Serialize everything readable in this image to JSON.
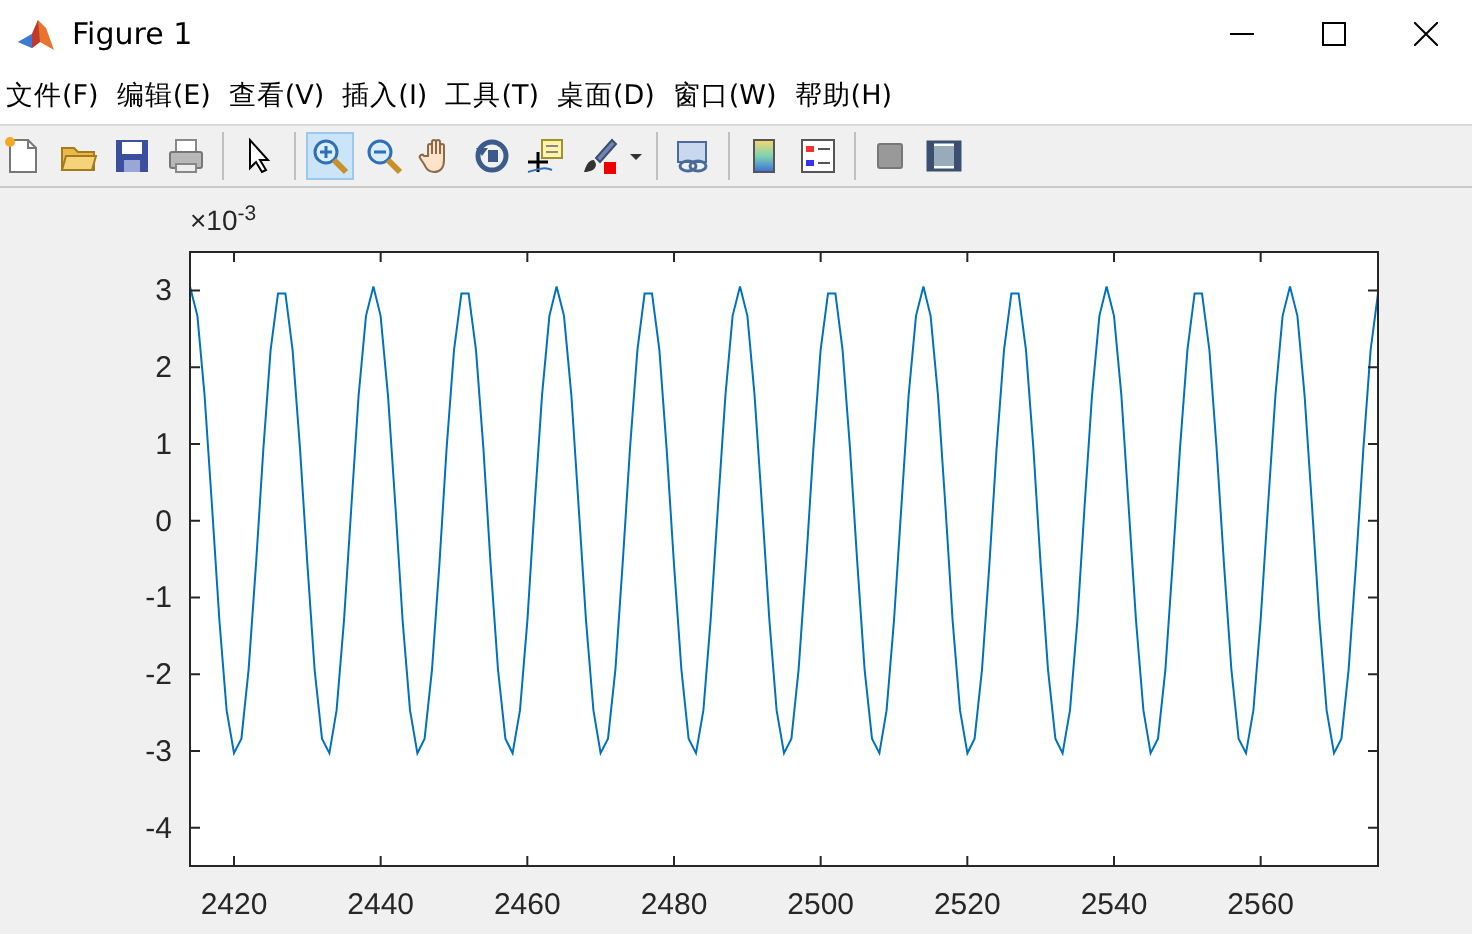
{
  "window": {
    "title": "Figure 1"
  },
  "menu": [
    {
      "label": "文件(F)"
    },
    {
      "label": "编辑(E)"
    },
    {
      "label": "查看(V)"
    },
    {
      "label": "插入(I)"
    },
    {
      "label": "工具(T)"
    },
    {
      "label": "桌面(D)"
    },
    {
      "label": "窗口(W)"
    },
    {
      "label": "帮助(H)"
    }
  ],
  "toolbar": [
    [
      {
        "kind": "new",
        "selected": false
      },
      {
        "kind": "open",
        "selected": false
      },
      {
        "kind": "save",
        "selected": false
      },
      {
        "kind": "print",
        "selected": false
      }
    ],
    [
      {
        "kind": "pointer",
        "selected": false
      }
    ],
    [
      {
        "kind": "zoomin",
        "selected": true
      },
      {
        "kind": "zoomout",
        "selected": false
      },
      {
        "kind": "pan",
        "selected": false
      },
      {
        "kind": "rotate",
        "selected": false
      },
      {
        "kind": "datacursor",
        "selected": false
      },
      {
        "kind": "brush",
        "selected": false
      }
    ],
    [
      {
        "kind": "link",
        "selected": false
      }
    ],
    [
      {
        "kind": "colorbar",
        "selected": false
      },
      {
        "kind": "legend",
        "selected": false
      }
    ],
    [
      {
        "kind": "hidetools",
        "selected": false
      },
      {
        "kind": "showtools",
        "selected": false
      }
    ]
  ],
  "axes": {
    "exponent": "×10$^{-3}$",
    "chart_data": {
      "type": "line",
      "xlim": [
        2414,
        2576
      ],
      "ylim": [
        -4.5,
        3.5
      ],
      "xticks": [
        2420,
        2440,
        2460,
        2480,
        2500,
        2520,
        2540,
        2560
      ],
      "yticks": [
        -4,
        -3,
        -2,
        -1,
        0,
        1,
        2,
        3
      ],
      "x": [
        2414,
        2415,
        2416,
        2417,
        2418,
        2419,
        2420,
        2421,
        2422,
        2423,
        2424,
        2425,
        2426,
        2427,
        2428,
        2429,
        2430,
        2431,
        2432,
        2433,
        2434,
        2435,
        2436,
        2437,
        2438,
        2439,
        2440,
        2441,
        2442,
        2443,
        2444,
        2445,
        2446,
        2447,
        2448,
        2449,
        2450,
        2451,
        2452,
        2453,
        2454,
        2455,
        2456,
        2457,
        2458,
        2459,
        2460,
        2461,
        2462,
        2463,
        2464,
        2465,
        2466,
        2467,
        2468,
        2469,
        2470,
        2471,
        2472,
        2473,
        2474,
        2475,
        2476,
        2477,
        2478,
        2479,
        2480,
        2481,
        2482,
        2483,
        2484,
        2485,
        2486,
        2487,
        2488,
        2489,
        2490,
        2491,
        2492,
        2493,
        2494,
        2495,
        2496,
        2497,
        2498,
        2499,
        2500,
        2501,
        2502,
        2503,
        2504,
        2505,
        2506,
        2507,
        2508,
        2509,
        2510,
        2511,
        2512,
        2513,
        2514,
        2515,
        2516,
        2517,
        2518,
        2519,
        2520,
        2521,
        2522,
        2523,
        2524,
        2525,
        2526,
        2527,
        2528,
        2529,
        2530,
        2531,
        2532,
        2533,
        2534,
        2535,
        2536,
        2537,
        2538,
        2539,
        2540,
        2541,
        2542,
        2543,
        2544,
        2545,
        2546,
        2547,
        2548,
        2549,
        2550,
        2551,
        2552,
        2553,
        2554,
        2555,
        2556,
        2557,
        2558,
        2559,
        2560,
        2561,
        2562,
        2563,
        2564,
        2565,
        2566,
        2567,
        2568,
        2569,
        2570,
        2571,
        2572,
        2573,
        2574,
        2575,
        2576
      ],
      "series": [
        {
          "color": "#0072bd",
          "values": [
            3.05,
            2.67,
            1.63,
            0.19,
            -1.3,
            -2.47,
            -3.03,
            -2.84,
            -1.94,
            -0.57,
            0.94,
            2.22,
            2.96,
            2.96,
            2.22,
            0.94,
            -0.57,
            -1.94,
            -2.84,
            -3.03,
            -2.47,
            -1.3,
            0.19,
            1.63,
            2.67,
            3.05,
            2.67,
            1.63,
            0.19,
            -1.3,
            -2.47,
            -3.03,
            -2.84,
            -1.94,
            -0.57,
            0.94,
            2.22,
            2.96,
            2.96,
            2.22,
            0.94,
            -0.57,
            -1.94,
            -2.84,
            -3.03,
            -2.47,
            -1.3,
            0.19,
            1.63,
            2.67,
            3.05,
            2.67,
            1.63,
            0.19,
            -1.3,
            -2.47,
            -3.03,
            -2.84,
            -1.94,
            -0.57,
            0.94,
            2.22,
            2.96,
            2.96,
            2.22,
            0.94,
            -0.57,
            -1.94,
            -2.84,
            -3.03,
            -2.47,
            -1.3,
            0.19,
            1.63,
            2.67,
            3.05,
            2.67,
            1.63,
            0.19,
            -1.3,
            -2.47,
            -3.03,
            -2.84,
            -1.94,
            -0.57,
            0.94,
            2.22,
            2.96,
            2.96,
            2.22,
            0.94,
            -0.57,
            -1.94,
            -2.84,
            -3.03,
            -2.47,
            -1.3,
            0.19,
            1.63,
            2.67,
            3.05,
            2.67,
            1.63,
            0.19,
            -1.3,
            -2.47,
            -3.03,
            -2.84,
            -1.94,
            -0.57,
            0.94,
            2.22,
            2.96,
            2.96,
            2.22,
            0.94,
            -0.57,
            -1.94,
            -2.84,
            -3.03,
            -2.47,
            -1.3,
            0.19,
            1.63,
            2.67,
            3.05,
            2.67,
            1.63,
            0.19,
            -1.3,
            -2.47,
            -3.03,
            -2.84,
            -1.94,
            -0.57,
            0.94,
            2.22,
            2.96,
            2.96,
            2.22,
            0.94,
            -0.57,
            -1.94,
            -2.84,
            -3.03,
            -2.47,
            -1.3,
            0.19,
            1.63,
            2.67,
            3.05,
            2.67,
            1.63,
            0.19,
            -1.3,
            -2.47,
            -3.03,
            -2.84,
            -1.94,
            -0.57,
            0.94,
            2.22,
            2.96
          ]
        }
      ]
    }
  }
}
